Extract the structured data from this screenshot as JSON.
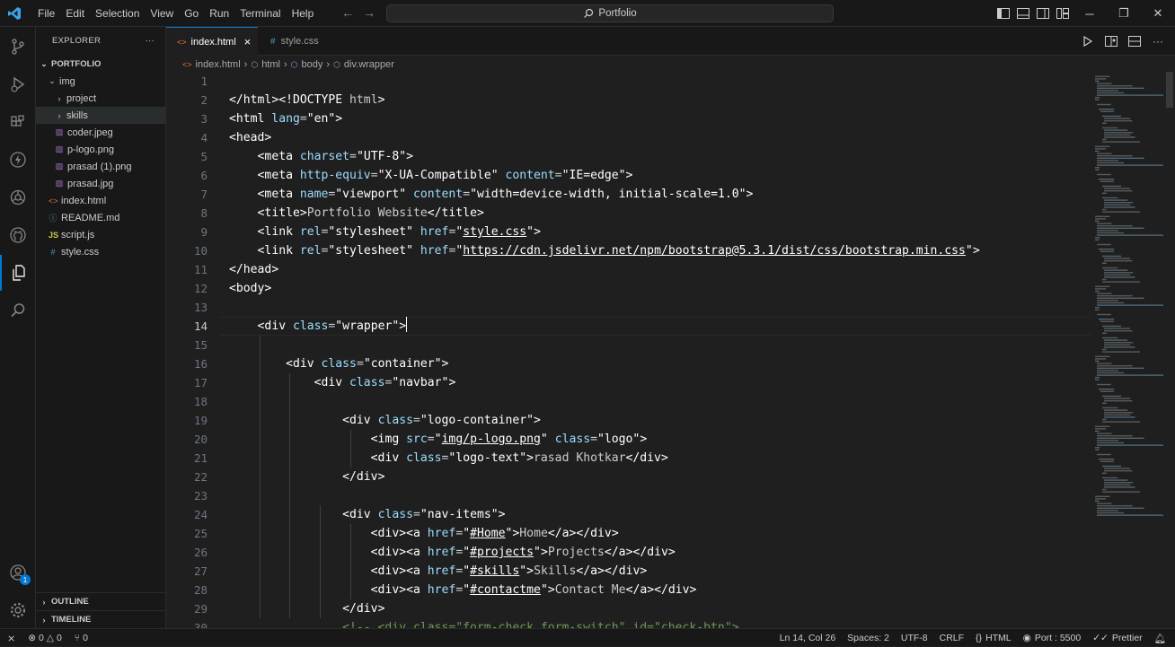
{
  "menu": [
    "File",
    "Edit",
    "Selection",
    "View",
    "Go",
    "Run",
    "Terminal",
    "Help"
  ],
  "command_center": "Portfolio",
  "explorer": {
    "title": "EXPLORER",
    "more": "···",
    "root": "PORTFOLIO",
    "items": [
      {
        "label": "img",
        "kind": "folder-open"
      },
      {
        "label": "project",
        "kind": "folder"
      },
      {
        "label": "skills",
        "kind": "folder"
      },
      {
        "label": "coder.jpeg",
        "kind": "image"
      },
      {
        "label": "p-logo.png",
        "kind": "image"
      },
      {
        "label": "prasad (1).png",
        "kind": "image"
      },
      {
        "label": "prasad.jpg",
        "kind": "image"
      },
      {
        "label": "index.html",
        "kind": "html"
      },
      {
        "label": "README.md",
        "kind": "info"
      },
      {
        "label": "script.js",
        "kind": "js"
      },
      {
        "label": "style.css",
        "kind": "css"
      }
    ],
    "outline": "OUTLINE",
    "timeline": "TIMELINE"
  },
  "tabs": [
    {
      "label": "index.html",
      "icon": "html-icon",
      "close": "×"
    },
    {
      "label": "style.css",
      "icon": "css-icon"
    }
  ],
  "breadcrumbs": [
    "index.html",
    "html",
    "body",
    "div.wrapper"
  ],
  "editor": {
    "current_line": 14,
    "lines": [
      {
        "n": "1",
        "t": ""
      },
      {
        "n": "2",
        "t": "</html><!DOCTYPE html>"
      },
      {
        "n": "3",
        "t": "<html lang=\"en\">"
      },
      {
        "n": "4",
        "t": "<head>"
      },
      {
        "n": "5",
        "t": "    <meta charset=\"UTF-8\">"
      },
      {
        "n": "6",
        "t": "    <meta http-equiv=\"X-UA-Compatible\" content=\"IE=edge\">"
      },
      {
        "n": "7",
        "t": "    <meta name=\"viewport\" content=\"width=device-width, initial-scale=1.0\">"
      },
      {
        "n": "8",
        "t": "    <title>Portfolio Website</title>"
      },
      {
        "n": "9",
        "t": "    <link rel=\"stylesheet\" href=\"style.css\">"
      },
      {
        "n": "10",
        "t": "    <link rel=\"stylesheet\" href=\"https://cdn.jsdelivr.net/npm/bootstrap@5.3.1/dist/css/bootstrap.min.css\">"
      },
      {
        "n": "11",
        "t": "</head>"
      },
      {
        "n": "12",
        "t": "<body>"
      },
      {
        "n": "13",
        "t": ""
      },
      {
        "n": "14",
        "t": "    <div class=\"wrapper\">"
      },
      {
        "n": "15",
        "t": ""
      },
      {
        "n": "16",
        "t": "        <div class=\"container\">"
      },
      {
        "n": "17",
        "t": "            <div class=\"navbar\">"
      },
      {
        "n": "18",
        "t": ""
      },
      {
        "n": "19",
        "t": "                <div class=\"logo-container\">"
      },
      {
        "n": "20",
        "t": "                    <img src=\"img/p-logo.png\" class=\"logo\">"
      },
      {
        "n": "21",
        "t": "                    <div class=\"logo-text\">rasad Khotkar</div>"
      },
      {
        "n": "22",
        "t": "                </div>"
      },
      {
        "n": "23",
        "t": ""
      },
      {
        "n": "24",
        "t": "                <div class=\"nav-items\">"
      },
      {
        "n": "25",
        "t": "                    <div><a href=\"#Home\">Home</a></div>"
      },
      {
        "n": "26",
        "t": "                    <div><a href=\"#projects\">Projects</a></div>"
      },
      {
        "n": "27",
        "t": "                    <div><a href=\"#skills\">Skills</a></div>"
      },
      {
        "n": "28",
        "t": "                    <div><a href=\"#contactme\">Contact Me</a></div>"
      },
      {
        "n": "29",
        "t": "                </div>"
      },
      {
        "n": "30",
        "t": "                <!-- <div class=\"form-check form-switch\" id=\"check-btn\">"
      }
    ]
  },
  "status": {
    "errors": "0",
    "warnings": "0",
    "ports": "0",
    "position": "Ln 14, Col 26",
    "spaces": "Spaces: 2",
    "encoding": "UTF-8",
    "eol": "CRLF",
    "language": "HTML",
    "port": "Port : 5500",
    "prettier": "Prettier"
  },
  "accounts_badge": "1",
  "colors": {
    "accent": "#0078d4",
    "bg": "#1f1f1f",
    "sidebar": "#181818",
    "attr": "#9cdcfe"
  }
}
